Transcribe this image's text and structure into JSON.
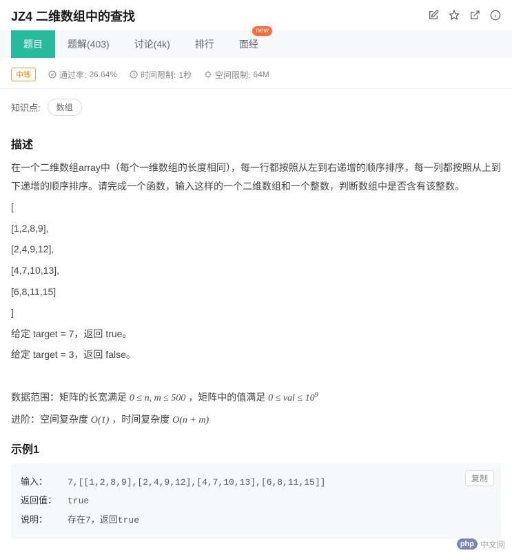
{
  "header": {
    "title": "JZ4 二维数组中的查找",
    "icons": [
      "edit-icon",
      "star-icon",
      "share-icon",
      "info-icon"
    ]
  },
  "tabs": [
    {
      "label": "题目",
      "active": true
    },
    {
      "label": "题解(403)"
    },
    {
      "label": "讨论(4k)"
    },
    {
      "label": "排行"
    },
    {
      "label": "面经",
      "badge": "new"
    }
  ],
  "meta": {
    "difficulty": "中等",
    "pass_label": "通过率:",
    "pass_rate": "26.64%",
    "time_label": "时间限制:",
    "time_limit": "1秒",
    "mem_label": "空间限制:",
    "mem_limit": "64M"
  },
  "tags": {
    "label": "知识点:",
    "items": [
      "数组"
    ]
  },
  "description": {
    "heading": "描述",
    "para": "在一个二维数组array中（每个一维数组的长度相同），每一行都按照从左到右递增的顺序排序，每一列都按照从上到下递增的顺序排序。请完成一个函数，输入这样的一个二维数组和一个整数，判断数组中是否含有该整数。",
    "matrix_lines": [
      "[",
      "[1,2,8,9],",
      "[2,4,9,12],",
      "[4,7,10,13],",
      "[6,8,11,15]",
      "]"
    ],
    "given1": "给定 target = 7，返回 true。",
    "given2": "给定 target = 3，返回 false。",
    "range_prefix": "数据范围：矩阵的长宽满足 ",
    "range_math1": "0 ≤ n, m ≤ 500",
    "range_mid": " ，矩阵中的值满足 ",
    "range_math2": "0 ≤ val ≤ 10",
    "range_exp": "9",
    "advance_prefix": "进阶：空间复杂度 ",
    "advance_o1": "O(1)",
    "advance_mid": " ，时间复杂度 ",
    "advance_onm": "O(n + m)"
  },
  "example": {
    "heading": "示例1",
    "input_label": "输入：",
    "input_val": "7,[[1,2,8,9],[2,4,9,12],[4,7,10,13],[6,8,11,15]]",
    "return_label": "返回值：",
    "return_val": "true",
    "note_label": "说明：",
    "note_val": "存在7，返回true",
    "copy_label": "复制"
  },
  "watermark": {
    "php": "php",
    "text": "中文网"
  }
}
